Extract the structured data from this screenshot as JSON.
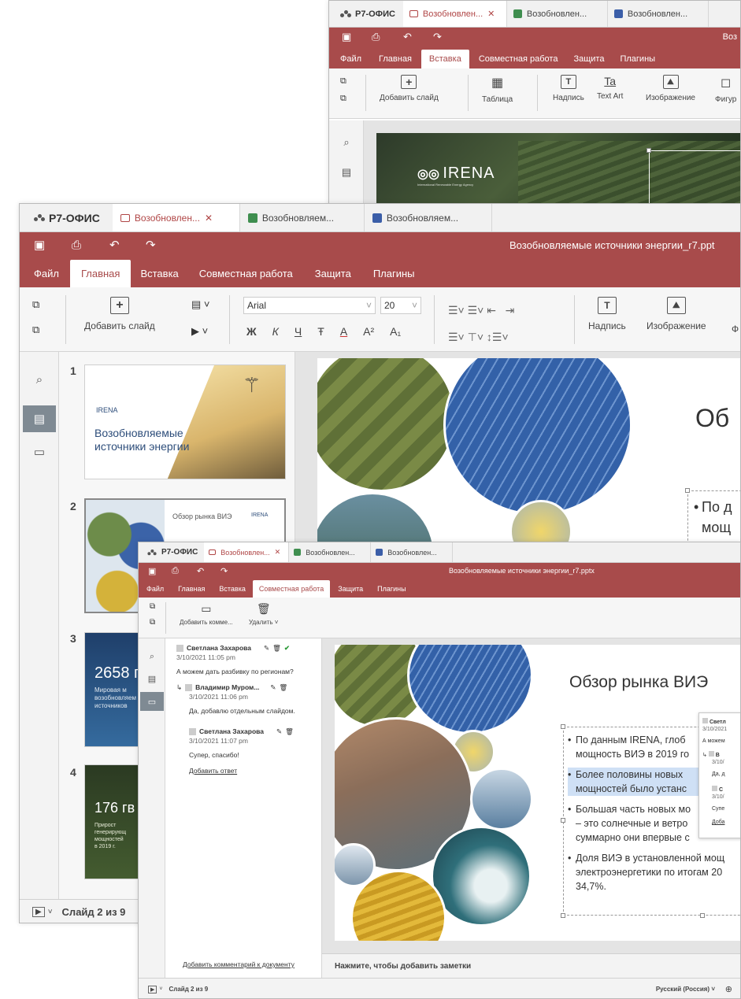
{
  "app": {
    "logo": "Р7-ОФИС"
  },
  "tabs": {
    "pres_full": "Возобновляем...",
    "sheet_full": "Возобновляем...",
    "doc_full": "Возобновляем...",
    "pres_short": "Возобновлен...",
    "sheet_short": "Возобновлен...",
    "doc_short": "Возобновлен..."
  },
  "doc_title": "Возобновляемые источники энергии_r7.pptx",
  "doc_title_cut_mid": "Возобновляемые источники энергии_r7.ppt",
  "doc_title_cut_back": "Воз",
  "menu": {
    "file": "Файл",
    "home": "Главная",
    "insert": "Вставка",
    "collab": "Совместная работа",
    "protect": "Защита",
    "plugins": "Плагины"
  },
  "ribbon": {
    "add_slide": "Добавить слайд",
    "table": "Таблица",
    "textbox": "Надпись",
    "textart": "Text Art",
    "image": "Изображение",
    "shape_cut": "Фигур",
    "shape_cut2": "Ф",
    "font_name": "Arial",
    "font_size": "20",
    "bold": "Ж",
    "italic": "К",
    "underline": "Ч",
    "strike": "Ŧ",
    "color_a": "А",
    "sup": "A²",
    "sub": "A₁",
    "add_comment": "Добавить комме...",
    "delete": "Удалить"
  },
  "slide_main": {
    "title": "Обзор рынка ВИЭ",
    "title_cut": "Об",
    "bullets": [
      "По данным IRENA, глоб",
      "мощность ВИЭ в 2019 го",
      "Более половины новых",
      "мощностей было устанс",
      "Большая часть новых мо",
      "– это солнечные и ветро",
      "суммарно они впервые с",
      "Доля ВИЭ в установленной мощ",
      "электроэнергетики по итогам 20",
      "34,7%."
    ],
    "bullet_mid_1": "По д",
    "bullet_mid_2": "мощ"
  },
  "back_slide": {
    "brand": "IRENA",
    "brand_sub": "International Renewable Energy Agency"
  },
  "thumbs": {
    "t1_num": "1",
    "t1_title_1": "Возобновляемые",
    "t1_title_2": "источники энергии",
    "t1_brand": "IRENA",
    "t2_num": "2",
    "t2_title": "Обзор рынка ВИЭ",
    "t2_brand": "IRENA",
    "t3_num": "3",
    "t3_big": "2658 г",
    "t3_sub_1": "Мировая м",
    "t3_sub_2": "возобновляем",
    "t3_sub_3": "источников",
    "t4_num": "4",
    "t4_big": "176 гв",
    "t4_sub_1": "Прирост",
    "t4_sub_2": "генерирующ",
    "t4_sub_3": "мощностей",
    "t4_sub_4": "в 2019 г."
  },
  "status": {
    "slide_of": "Слайд 2 из 9",
    "language": "Русский (Россия)"
  },
  "notes_placeholder": "Нажмите, чтобы добавить заметки",
  "comments": {
    "c1_author": "Светлана Захарова",
    "c1_date": "3/10/2021 11:05 pm",
    "c1_text": "А можем дать разбивку по регионам?",
    "r1_author": "Владимир Муром...",
    "r1_date": "3/10/2021 11:06 pm",
    "r1_text": "Да, добавлю отдельным слайдом.",
    "r2_author": "Светлана Захарова",
    "r2_date": "3/10/2021 11:07 pm",
    "r2_text": "Супер, спасибо!",
    "add_reply": "Добавить ответ",
    "add_doc_comment": "Добавить комментарий к документу"
  },
  "popup": {
    "name_cut": "Светл",
    "date_cut": "3/10/2021",
    "text_cut": "А можем",
    "r_name_cut": "В",
    "r_date_cut": "3/10/",
    "r_text_cut": "Да, д",
    "r2_name_cut": "С",
    "r2_date_cut": "3/10/",
    "r2_text_cut": "Супе",
    "add_cut": "Доба"
  },
  "colors": {
    "accent": "#a84b4b",
    "accent_text": "#b04646",
    "sheet": "#3f8e4f",
    "doc": "#3b5ea8",
    "check": "#2e9b3a",
    "highlight": "#cfe0f5"
  }
}
